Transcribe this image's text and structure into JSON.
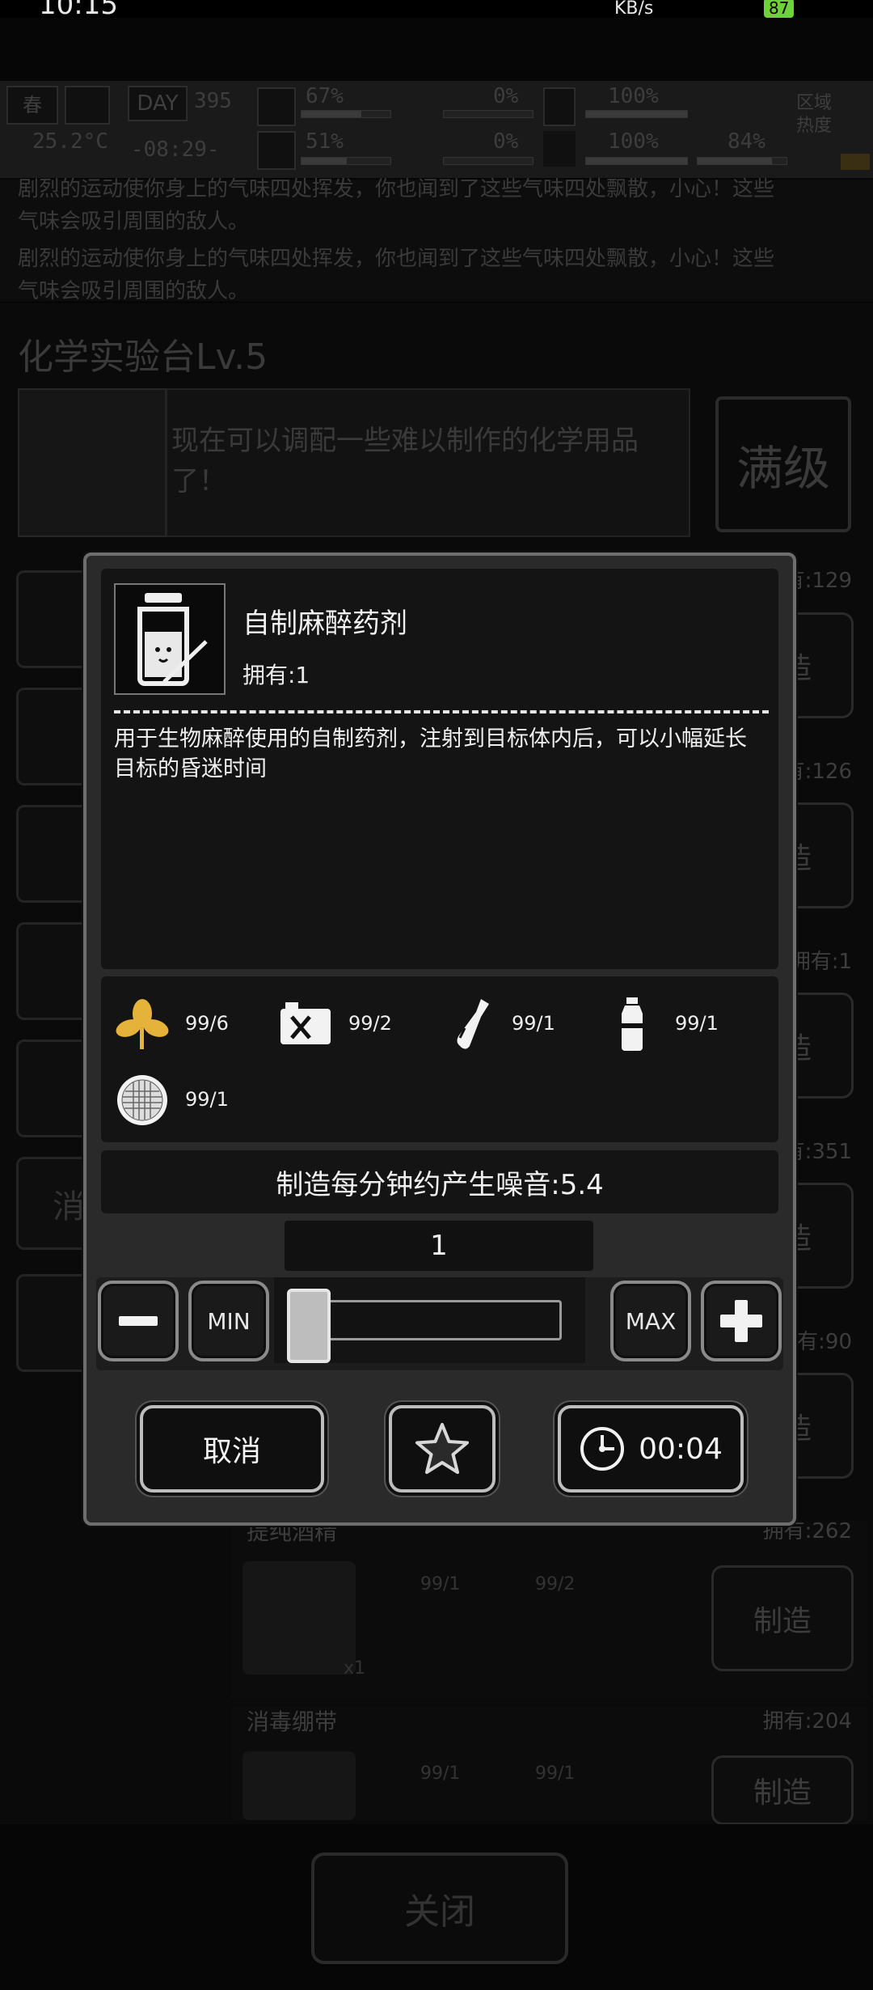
{
  "status_bar": {
    "time": "10:15",
    "speed": "KB/s",
    "battery": "87"
  },
  "hud": {
    "season": "春",
    "temperature": "25.2°C",
    "day_label": "DAY",
    "day_number": "395",
    "clock": "-08:29-",
    "health_pct": "67%",
    "energy_pct": "51%",
    "bleed_pct": "0%",
    "infection_pct": "0%",
    "food_pct": "100%",
    "mood_pct": "100%",
    "water_pct": "84%",
    "zone_heat_label": "区域热度",
    "health_bar": 0.67,
    "energy_bar": 0.51,
    "bleed_bar": 0.0,
    "infection_bar": 0.0,
    "food_bar": 1.0,
    "mood_bar": 1.0,
    "water_bar": 0.84
  },
  "log": {
    "line1": "剧烈的运动使你身上的气味四处挥发，你也闻到了这些气味四处飘散，小心！这些",
    "line2": "气味会吸引周围的敌人。",
    "line3": "剧烈的运动使你身上的气味四处挥发，你也闻到了这些气味四处飘散，小心！这些",
    "line4": "气味会吸引周围的敌人。"
  },
  "bench": {
    "title": "化学实验台Lv.5",
    "description": "现在可以调配一些难以制作的化学用品了！",
    "max_label": "满级",
    "close_label": "关闭",
    "craft_label": "制造",
    "right_owned": [
      "有:129",
      "有:126",
      "拥有:1",
      "有:351",
      "有:90"
    ],
    "rows": [
      {
        "title": "提纯酒精",
        "owned": "拥有:262",
        "ing1": "99/1",
        "ing2": "99/2",
        "count": "x1"
      },
      {
        "title": "消毒绷带",
        "owned": "拥有:204",
        "ing1": "99/1",
        "ing2": "99/1"
      }
    ],
    "left_partial": [
      "消"
    ]
  },
  "modal": {
    "item_name": "自制麻醉药剂",
    "owned": "拥有:1",
    "description": "用于生物麻醉使用的自制药剂，注射到目标体内后，可以小幅延长目标的昏迷时间",
    "ingredients": [
      {
        "icon": "herb-icon",
        "qty": "99/6"
      },
      {
        "icon": "fuel-can-icon",
        "qty": "99/2"
      },
      {
        "icon": "glass-bottle-icon",
        "qty": "99/1"
      },
      {
        "icon": "water-bottle-icon",
        "qty": "99/1"
      },
      {
        "icon": "filter-mesh-icon",
        "qty": "99/1"
      }
    ],
    "noise_text": "制造每分钟约产生噪音:5.4",
    "quantity": "1",
    "min_label": "MIN",
    "max_label": "MAX",
    "slider_value": 0,
    "cancel_label": "取消",
    "timer_label": "00:04"
  }
}
